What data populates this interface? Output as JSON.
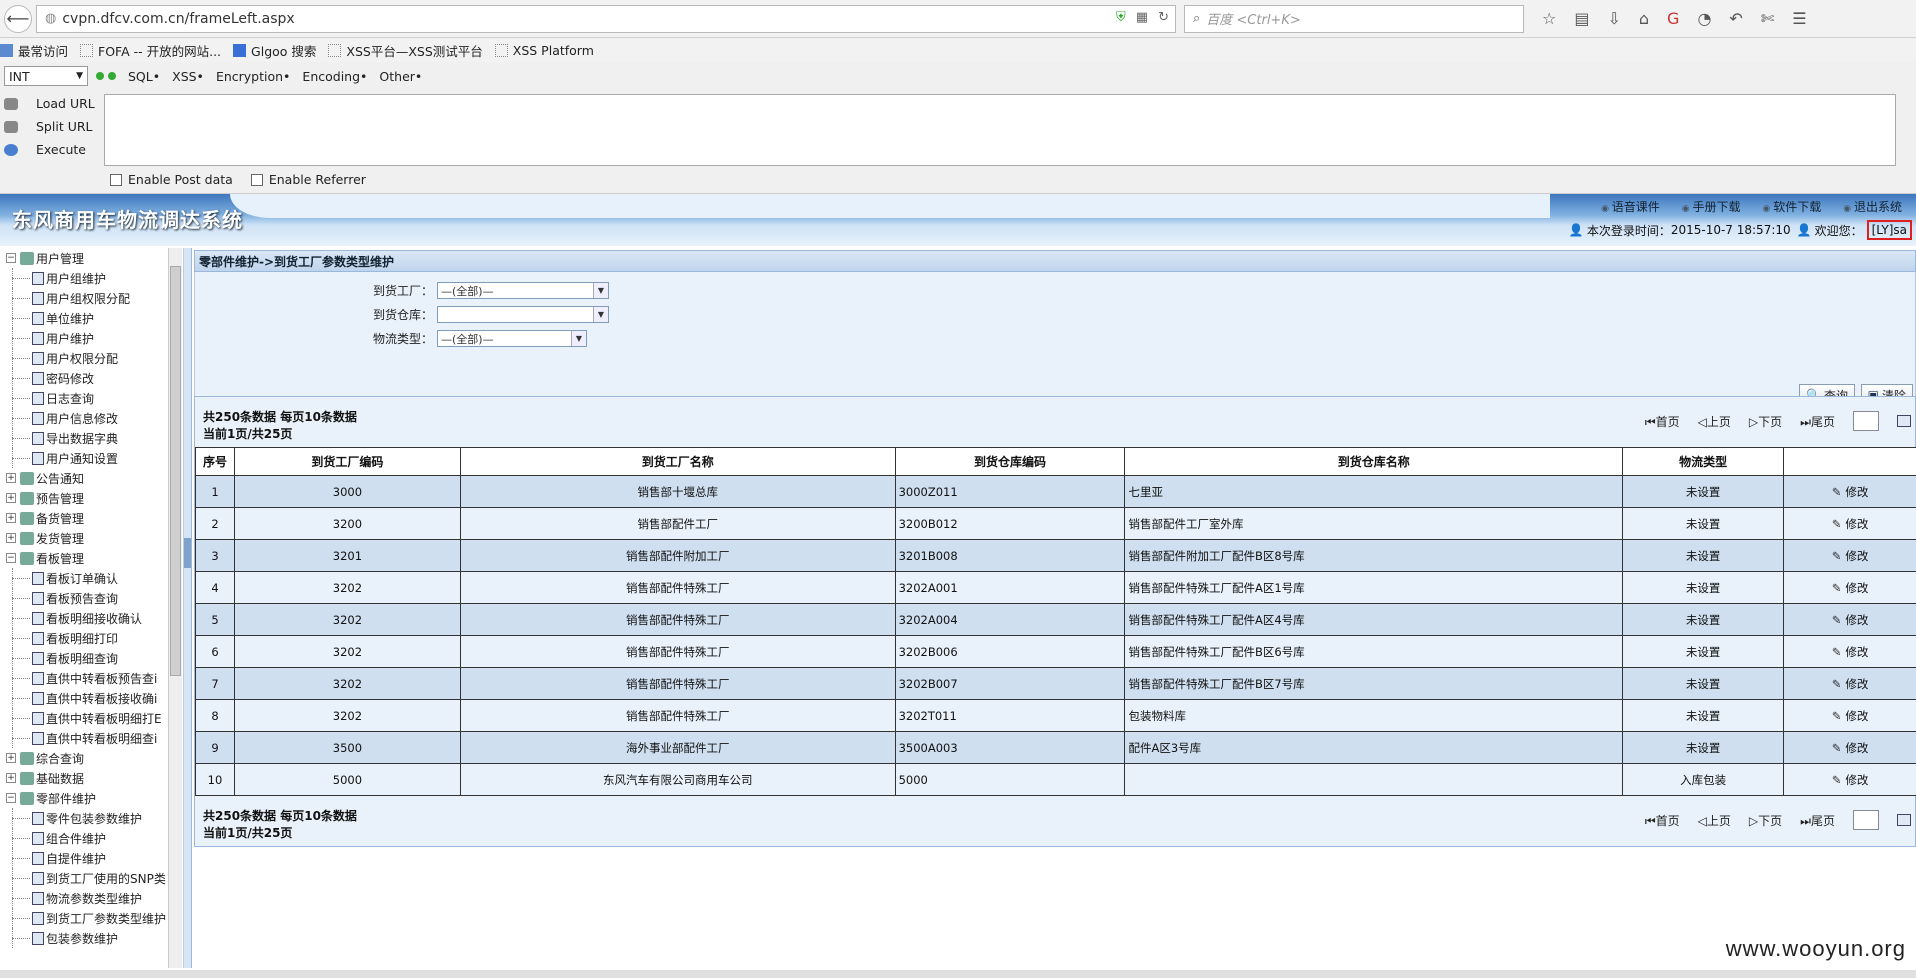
{
  "browser": {
    "url": "cvpn.dfcv.com.cn/frameLeft.aspx",
    "url_host": "cvpn.dfcv.com.cn",
    "url_path": "/frameLeft.aspx",
    "search_placeholder": "百度 <Ctrl+K>"
  },
  "bookmarks": [
    "最常访问",
    "FOFA -- 开放的网站...",
    "Glgoo 搜索",
    "XSS平台—XSS测试平台",
    "XSS Platform"
  ],
  "hackbar": {
    "select_value": "INT",
    "menus": [
      "SQL•",
      "XSS•",
      "Encryption•",
      "Encoding•",
      "Other•"
    ],
    "actions": [
      "Load URL",
      "Split URL",
      "Execute"
    ],
    "checks": [
      "Enable Post data",
      "Enable Referrer"
    ]
  },
  "app": {
    "logo": "东风商用车物流调达系统",
    "links": [
      "语音课件",
      "手册下载",
      "软件下载",
      "退出系统"
    ],
    "login_label": "本次登录时间：",
    "login_time": "2015-10-7 18:57:10",
    "welcome": "欢迎您：",
    "user": "[LY]sa"
  },
  "tree": [
    {
      "group": "用户管理",
      "open": true,
      "items": [
        "用户组维护",
        "用户组权限分配",
        "单位维护",
        "用户维护",
        "用户权限分配",
        "密码修改",
        "日志查询",
        "用户信息修改",
        "导出数据字典",
        "用户通知设置"
      ]
    },
    {
      "group": "公告通知",
      "open": false,
      "items": []
    },
    {
      "group": "预告管理",
      "open": false,
      "items": []
    },
    {
      "group": "备货管理",
      "open": false,
      "items": []
    },
    {
      "group": "发货管理",
      "open": false,
      "items": []
    },
    {
      "group": "看板管理",
      "open": true,
      "items": [
        "看板订单确认",
        "看板预告查询",
        "看板明细接收确认",
        "看板明细打印",
        "看板明细查询",
        "直供中转看板预告查i",
        "直供中转看板接收确i",
        "直供中转看板明细打E",
        "直供中转看板明细查i"
      ]
    },
    {
      "group": "综合查询",
      "open": false,
      "items": []
    },
    {
      "group": "基础数据",
      "open": false,
      "items": []
    },
    {
      "group": "零部件维护",
      "open": true,
      "items": [
        "零件包装参数维护",
        "组合件维护",
        "自提件维护",
        "到货工厂使用的SNP类",
        "物流参数类型维护",
        "到货工厂参数类型维护",
        "包装参数维护"
      ]
    }
  ],
  "breadcrumb": "零部件维护->到货工厂参数类型维护",
  "filters": [
    {
      "label": "到货工厂：",
      "value": "—(全部)—"
    },
    {
      "label": "到货仓库：",
      "value": ""
    },
    {
      "label": "物流类型：",
      "value": "—(全部)—"
    }
  ],
  "buttons": {
    "query": "查询",
    "clear": "清除"
  },
  "pager": {
    "total": "共250条数据  每页10条数据",
    "current": "当前1页/共25页",
    "first": "首页",
    "prev": "上页",
    "next": "下页",
    "last": "尾页"
  },
  "table": {
    "headers": [
      "序号",
      "到货工厂编码",
      "到货工厂名称",
      "到货仓库编码",
      "到货仓库名称",
      "物流类型",
      ""
    ],
    "edit_label": "修改",
    "rows": [
      [
        "1",
        "3000",
        "销售部十堰总库",
        "3000Z011",
        "七里亚",
        "未设置"
      ],
      [
        "2",
        "3200",
        "销售部配件工厂",
        "3200B012",
        "销售部配件工厂室外库",
        "未设置"
      ],
      [
        "3",
        "3201",
        "销售部配件附加工厂",
        "3201B008",
        "销售部配件附加工厂配件B区8号库",
        "未设置"
      ],
      [
        "4",
        "3202",
        "销售部配件特殊工厂",
        "3202A001",
        "销售部配件特殊工厂配件A区1号库",
        "未设置"
      ],
      [
        "5",
        "3202",
        "销售部配件特殊工厂",
        "3202A004",
        "销售部配件特殊工厂配件A区4号库",
        "未设置"
      ],
      [
        "6",
        "3202",
        "销售部配件特殊工厂",
        "3202B006",
        "销售部配件特殊工厂配件B区6号库",
        "未设置"
      ],
      [
        "7",
        "3202",
        "销售部配件特殊工厂",
        "3202B007",
        "销售部配件特殊工厂配件B区7号库",
        "未设置"
      ],
      [
        "8",
        "3202",
        "销售部配件特殊工厂",
        "3202T011",
        "包装物料库",
        "未设置"
      ],
      [
        "9",
        "3500",
        "海外事业部配件工厂",
        "3500A003",
        "配件A区3号库",
        "未设置"
      ],
      [
        "10",
        "5000",
        "东风汽车有限公司商用车公司",
        "5000",
        "",
        "入库包装"
      ]
    ]
  },
  "watermark": "www.wooyun.org"
}
